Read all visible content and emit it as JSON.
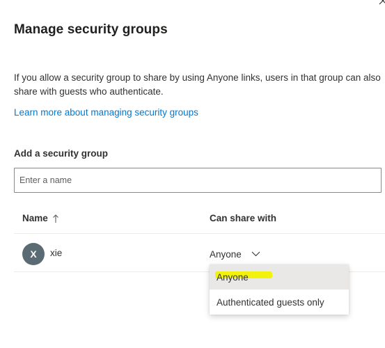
{
  "panel": {
    "title": "Manage security groups",
    "description": "If you allow a security group to share by using Anyone links, users in that group can also share with guests who authenticate.",
    "learn_more_link": "Learn more about managing security groups"
  },
  "add_group": {
    "label": "Add a security group",
    "placeholder": "Enter a name"
  },
  "table": {
    "columns": {
      "name": "Name",
      "can_share_with": "Can share with"
    },
    "sort_icon": "arrow-up-icon",
    "rows": [
      {
        "avatar_initial": "X",
        "name": "xie",
        "can_share_with": "Anyone"
      }
    ]
  },
  "dropdown_menu": {
    "options": [
      {
        "label": "Anyone",
        "selected": true
      },
      {
        "label": "Authenticated guests only",
        "selected": false
      }
    ]
  },
  "colors": {
    "link": "#0078d4",
    "avatar_bg": "#5a6b73",
    "highlight": "#f2f200",
    "selected_option_bg": "#e9e8e7"
  }
}
